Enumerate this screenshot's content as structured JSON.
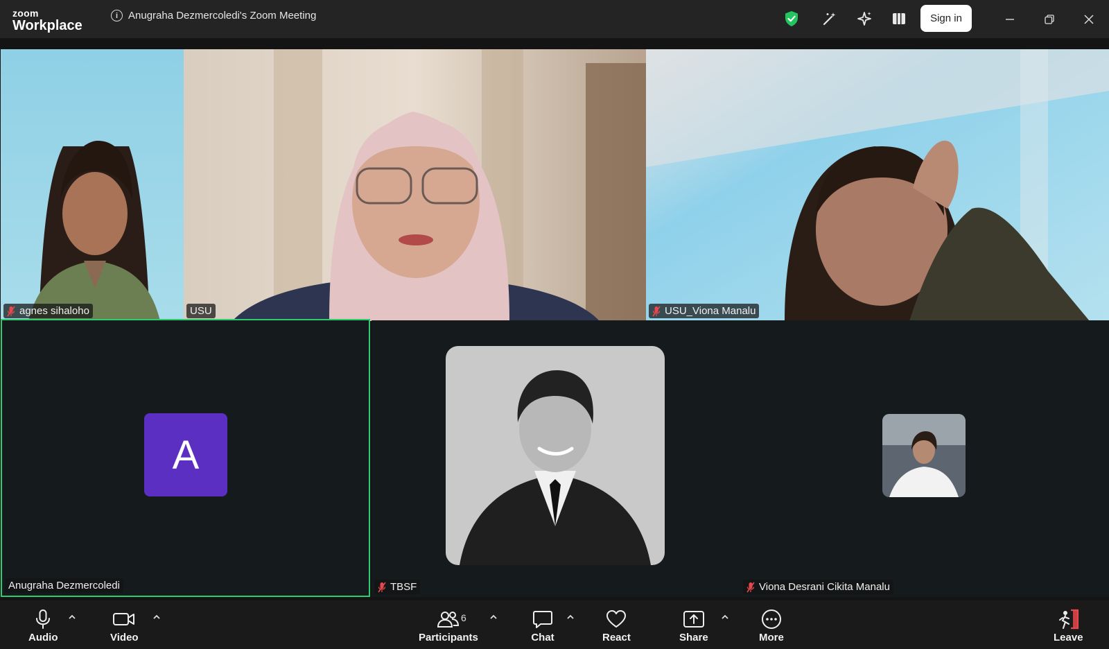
{
  "app": {
    "logo_top": "zoom",
    "logo_bottom": "Workplace",
    "meeting_title": "Anugraha Dezmercoledi's Zoom Meeting",
    "sign_in_label": "Sign in"
  },
  "participants": [
    {
      "name": "agnes sihaloho",
      "muted": true
    },
    {
      "name": "USU",
      "muted": false
    },
    {
      "name": "USU_Viona Manalu",
      "muted": true
    },
    {
      "name": "Anugraha Dezmercoledi",
      "muted": false,
      "avatar_letter": "A",
      "active_speaker": true
    },
    {
      "name": "TBSF",
      "muted": true
    },
    {
      "name": "Viona Desrani Cikita Manalu",
      "muted": true
    }
  ],
  "toolbar": {
    "audio_label": "Audio",
    "video_label": "Video",
    "participants_label": "Participants",
    "participants_count": "6",
    "chat_label": "Chat",
    "react_label": "React",
    "share_label": "Share",
    "more_label": "More",
    "leave_label": "Leave"
  },
  "colors": {
    "titlebar_bg": "#242424",
    "active_speaker_border": "#2ecc71",
    "avatar_bg": "#5b2fc2",
    "security_shield": "#22c55e",
    "leave_accent": "#e5484d"
  }
}
